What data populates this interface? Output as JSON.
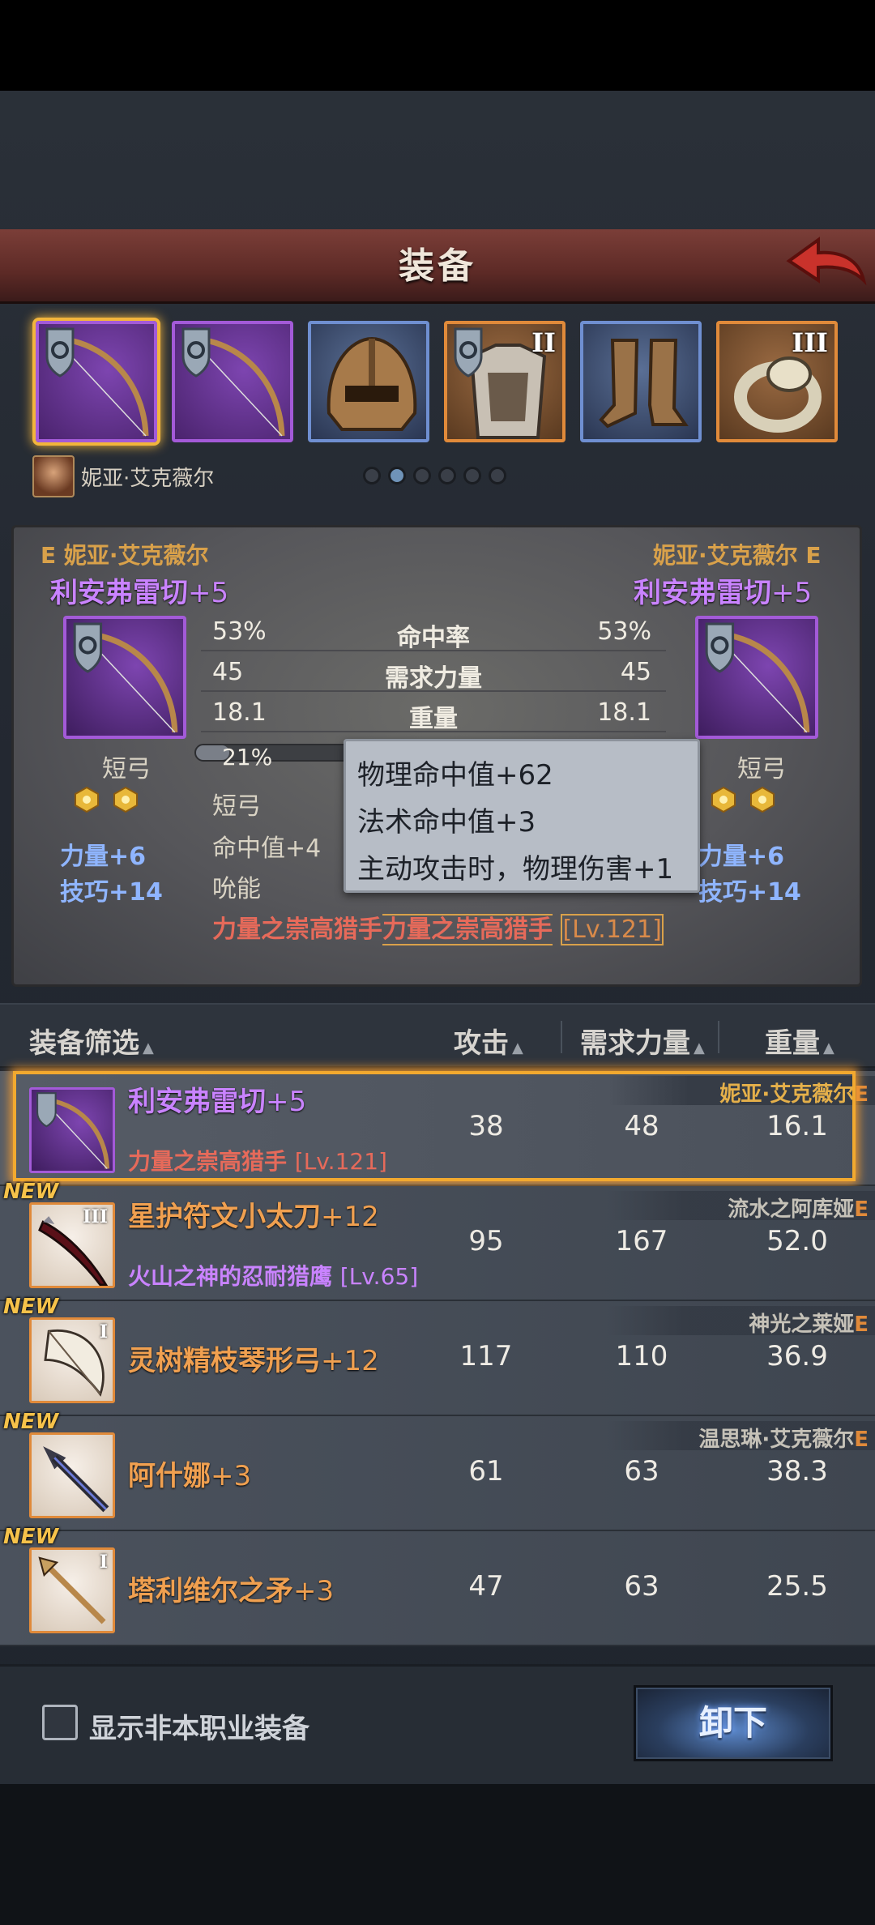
{
  "header": {
    "title": "装备"
  },
  "slots": [
    {
      "type": "bow",
      "rarity": "purple",
      "selected": true
    },
    {
      "type": "bow",
      "rarity": "purple"
    },
    {
      "type": "helmet",
      "rarity": "blue"
    },
    {
      "type": "armor",
      "rarity": "orange",
      "roman": "II"
    },
    {
      "type": "boots",
      "rarity": "blue"
    },
    {
      "type": "ring",
      "rarity": "orange",
      "roman": "III"
    }
  ],
  "character": {
    "name": "妮亚·艾克薇尔",
    "page_dots": 6,
    "active_dot": 1
  },
  "compare": {
    "left": {
      "rank": "E",
      "owner": "妮亚·艾克薇尔",
      "weapon_name": "利安弗雷切",
      "weapon_plus": "+5",
      "type": "短弓",
      "attr1": "力量+6",
      "attr2": "技巧+14"
    },
    "right": {
      "rank": "E",
      "owner": "妮亚·艾克薇尔",
      "weapon_name": "利安弗雷切",
      "weapon_plus": "+5",
      "type": "短弓",
      "attr1": "力量+6",
      "attr2": "技巧+14"
    },
    "stats": [
      {
        "label": "命中率",
        "left": "53%",
        "right": "53%"
      },
      {
        "label": "需求力量",
        "left": "45",
        "right": "45"
      },
      {
        "label": "重量",
        "left": "18.1",
        "right": "18.1"
      }
    ],
    "exp_percent": "21%",
    "exp_fraction": 0.21,
    "mid_type": "短弓",
    "mid_attr": "命中值+4",
    "mid_skill": "吮能",
    "set_line_1": "力量之崇高猎手",
    "set_line_2": "力量之崇高猎手",
    "set_lv": "[Lv.121]",
    "tooltip": {
      "line1": "物理命中值+62",
      "line2": "法术命中值+3",
      "line3": "主动攻击时，物理伤害+1"
    }
  },
  "list_header": {
    "filter": "装备筛选",
    "attack": "攻击",
    "req_str": "需求力量",
    "weight": "重量"
  },
  "items": [
    {
      "name": "利安弗雷切",
      "plus": "+5",
      "color": "purple",
      "set": "力量之崇高猎手",
      "set_lv": "[Lv.121]",
      "set_color": "red",
      "owner": "妮亚·艾克薇尔",
      "owner_rank": "E",
      "attack": "38",
      "req_str": "48",
      "weight": "16.1",
      "selected": true,
      "is_new": false
    },
    {
      "name": "星护符文小太刀",
      "plus": "+12",
      "color": "orange",
      "set": "火山之神的忍耐猎鹰",
      "set_lv": "[Lv.65]",
      "set_color": "purple",
      "owner": "流水之阿库娅",
      "owner_rank": "E",
      "attack": "95",
      "req_str": "167",
      "weight": "52.0",
      "is_new": true,
      "new_label": "NEW",
      "roman": "III"
    },
    {
      "name": "灵树精枝琴形弓",
      "plus": "+12",
      "color": "orange",
      "set": "",
      "set_lv": "",
      "owner": "神光之莱娅",
      "owner_rank": "E",
      "attack": "117",
      "req_str": "110",
      "weight": "36.9",
      "is_new": true,
      "new_label": "NEW",
      "roman": "I"
    },
    {
      "name": "阿什娜",
      "plus": "+3",
      "color": "orange",
      "set": "",
      "set_lv": "",
      "owner": "温思琳·艾克薇尔",
      "owner_rank": "E",
      "attack": "61",
      "req_str": "63",
      "weight": "38.3",
      "is_new": true,
      "new_label": "NEW",
      "roman": ""
    },
    {
      "name": "塔利维尔之矛",
      "plus": "+3",
      "color": "orange",
      "set": "",
      "set_lv": "",
      "owner": "",
      "owner_rank": "",
      "attack": "47",
      "req_str": "63",
      "weight": "25.5",
      "is_new": true,
      "new_label": "NEW",
      "roman": "I"
    }
  ],
  "bottom": {
    "checkbox_label": "显示非本职业装备",
    "checkbox_checked": false,
    "unequip_label": "卸下"
  },
  "colors": {
    "purple_rarity": "#a35ad8",
    "orange_rarity": "#e08a3a",
    "blue_rarity": "#6f8fd1",
    "selected_gold": "#f2b53c"
  }
}
